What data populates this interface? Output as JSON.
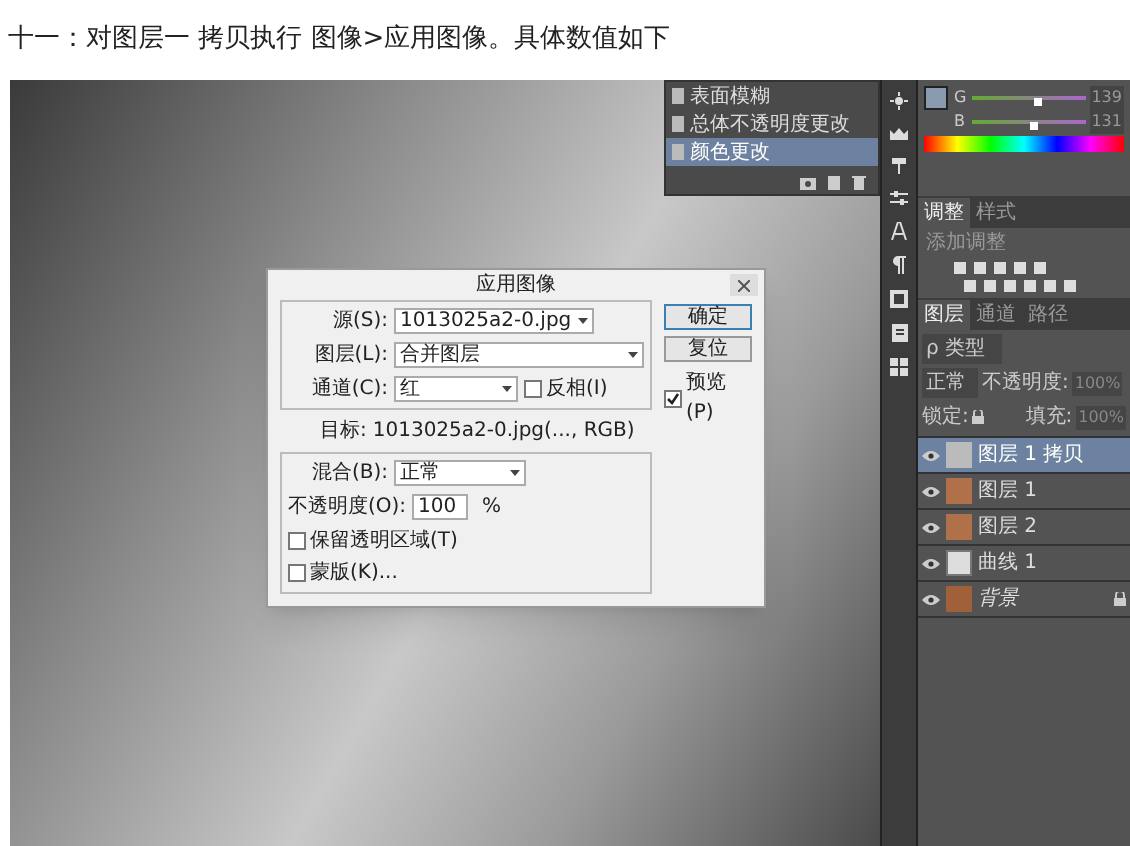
{
  "heading": "十一：对图层一 拷贝执行 图像>应用图像。具体数值如下",
  "history": {
    "items": [
      {
        "label": "表面模糊",
        "selected": false
      },
      {
        "label": "总体不透明度更改",
        "selected": false
      },
      {
        "label": "颜色更改",
        "selected": true
      }
    ]
  },
  "color_panel": {
    "sliders": [
      {
        "label": "G",
        "value": "139",
        "level": 0.55
      },
      {
        "label": "B",
        "value": "131",
        "level": 0.52
      }
    ]
  },
  "adjustments_panel": {
    "tabs": [
      {
        "label": "调整",
        "selected": true
      },
      {
        "label": "样式",
        "selected": false
      }
    ],
    "hint": "添加调整"
  },
  "layers_panel": {
    "tabs": [
      {
        "label": "图层",
        "selected": true
      },
      {
        "label": "通道",
        "selected": false
      },
      {
        "label": "路径",
        "selected": false
      }
    ],
    "filter": "ρ 类型",
    "blend_mode": "正常",
    "opacity_label": "不透明度:",
    "opacity": "100%",
    "lock_label": "锁定:",
    "fill_label": "填充:",
    "fill": "100%",
    "layers": [
      {
        "name": "图层 1 拷贝",
        "kind": "gray",
        "visible": true,
        "selected": true
      },
      {
        "name": "图层 1",
        "kind": "color",
        "visible": true,
        "selected": false
      },
      {
        "name": "图层 2",
        "kind": "color",
        "visible": true,
        "selected": false
      },
      {
        "name": "曲线 1",
        "kind": "adjustment",
        "visible": true,
        "selected": false
      },
      {
        "name": "背景",
        "kind": "background",
        "visible": true,
        "selected": false
      }
    ]
  },
  "dialog": {
    "title": "应用图像",
    "source_label": "源(S):",
    "source": "1013025a2-0.jpg",
    "layer_label": "图层(L):",
    "layer": "合并图层",
    "channel_label": "通道(C):",
    "channel": "红",
    "invert": {
      "label": "反相(I)",
      "checked": false
    },
    "target_label": "目标:",
    "target": "1013025a2-0.jpg(..., RGB)",
    "blend_label": "混合(B):",
    "blend": "正常",
    "opacity_label": "不透明度(O):",
    "opacity": "100",
    "opacity_unit": "%",
    "options": [
      {
        "label": "保留透明区域(T)",
        "checked": false
      },
      {
        "label": "蒙版(K)...",
        "checked": false
      }
    ],
    "buttons": [
      "确定",
      "复位"
    ],
    "preview": {
      "label": "预览(P)",
      "checked": true
    }
  }
}
